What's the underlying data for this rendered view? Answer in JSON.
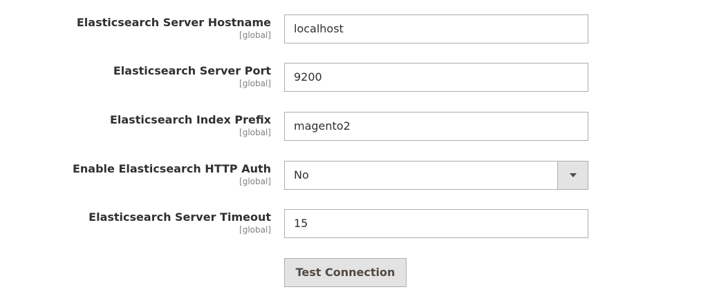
{
  "fields": [
    {
      "label": "Elasticsearch Server Hostname",
      "scope": "[global]",
      "value": "localhost"
    },
    {
      "label": "Elasticsearch Server Port",
      "scope": "[global]",
      "value": "9200"
    },
    {
      "label": "Elasticsearch Index Prefix",
      "scope": "[global]",
      "value": "magento2"
    },
    {
      "label": "Enable Elasticsearch HTTP Auth",
      "scope": "[global]",
      "value": "No"
    },
    {
      "label": "Elasticsearch Server Timeout",
      "scope": "[global]",
      "value": "15"
    }
  ],
  "test_connection_label": "Test Connection",
  "icons": {
    "select_arrow": "chevron-down-icon"
  }
}
